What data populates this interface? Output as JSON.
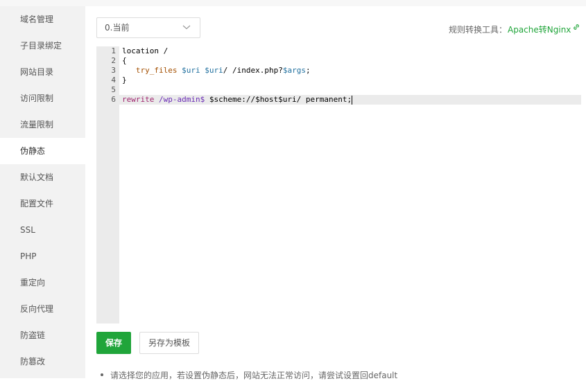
{
  "sidebar": {
    "items": [
      {
        "label": "域名管理"
      },
      {
        "label": "子目录绑定"
      },
      {
        "label": "网站目录"
      },
      {
        "label": "访问限制"
      },
      {
        "label": "流量限制"
      },
      {
        "label": "伪静态",
        "active": true
      },
      {
        "label": "默认文档"
      },
      {
        "label": "配置文件"
      },
      {
        "label": "SSL"
      },
      {
        "label": "PHP"
      },
      {
        "label": "重定向"
      },
      {
        "label": "反向代理"
      },
      {
        "label": "防盗链"
      },
      {
        "label": "防篡改"
      }
    ]
  },
  "template_select": {
    "value": "0.当前"
  },
  "converter": {
    "label": "规则转换工具：",
    "link": "Apache转Nginx"
  },
  "editor": {
    "line_numbers": [
      "1",
      "2",
      "3",
      "4",
      "5",
      "6"
    ],
    "lines": {
      "l1": "location /",
      "l2": "{",
      "l3": {
        "indent": "   ",
        "kw": "try_files",
        "v1": "$uri",
        "v2": "$uri",
        "mid": "/ /index.php?",
        "v3": "$args",
        "end": ";"
      },
      "l4": "}",
      "l6": {
        "kw": "rewrite",
        "re": "/wp-admin$",
        "rest": " $scheme://$host$uri/ permanent;"
      }
    }
  },
  "buttons": {
    "save": "保存",
    "save_template": "另存为模板"
  },
  "tips": [
    "请选择您的应用，若设置伪静态后，网站无法正常访问，请尝试设置回default"
  ],
  "colors": {
    "accent": "#20a53a"
  }
}
